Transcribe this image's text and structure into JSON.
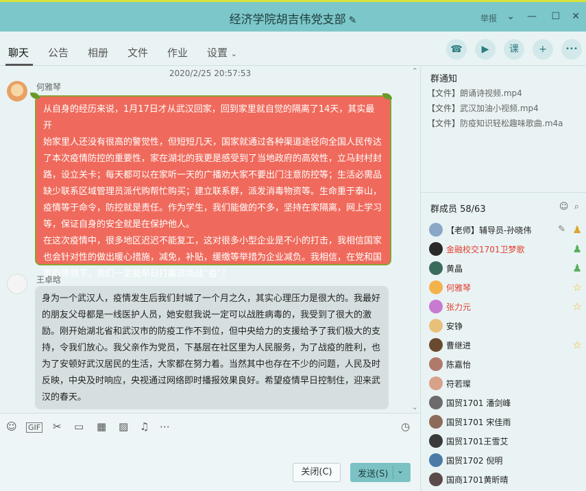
{
  "window": {
    "title": "经济学院胡吉伟党支部",
    "report_label": "举报",
    "controls": [
      "⌄",
      "—",
      "☐",
      "✕"
    ]
  },
  "tabs": [
    "聊天",
    "公告",
    "相册",
    "文件",
    "作业",
    "设置"
  ],
  "active_tab": "聊天",
  "header_icons": [
    "phone-icon",
    "video-icon",
    "class-icon",
    "add-chat-icon",
    "more-icon"
  ],
  "header_icon_glyphs": [
    "☎",
    "▶",
    "课",
    "+",
    "•••"
  ],
  "chat": {
    "timestamp": "2020/2/25 20:57:53",
    "messages": [
      {
        "sender": "何雅琴",
        "lines": [
          "从自身的经历来说，1月17日才从武汉回家，回到家里就自觉的隔离了14天，其实最开",
          "始家里人还没有很高的警觉性，但短短几天，国家就通过各种渠道途径向全国人民传达",
          "了本次疫情防控的重要性，家在湖北的我更是感受到了当地政府的高效性，立马封村封",
          "路，设立关卡；每天都可以在家听一天的广播劝大家不要出门注意防控等；生活必需品",
          "缺少联系区域管理员派代购帮忙购买；建立联系群，派发消毒物资等。生命重于泰山，",
          "疫情等于命令，防控就是责任。作为学生，我们能做的不多，坚持在家隔离，网上学习",
          "等，保证自身的安全就是在保护他人。",
          "在这次疫情中，很多地区迟迟不能复工，这对很多小型企业是不小的打击，我相信国家",
          "也会针对性的做出暖心措施，减免，补贴，缓缴等举措为企业减负。我相信，在党和国",
          "家的带领下，我们一定能早日打赢这场战“疫”！"
        ]
      },
      {
        "sender": "王卓晗",
        "lines": [
          "身为一个武汉人，疫情发生后我们封城了一个月之久，其实心理压力是很大的。我最好",
          "的朋友父母都是一线医护人员，她安慰我说一定可以战胜病毒的，我受到了很大的激",
          "励。刚开始湖北省和武汉市的防疫工作不到位，但中央给力的支援给予了我们极大的支",
          "持，令我们放心。我父亲作为党员，下基层在社区里为人民服务，为了战疫的胜利，也",
          "为了安顿好武汉居民的生活，大家都在努力着。当然其中也存在不少的问题，人民及时",
          "反映，中央及时响应，央视通过网络即时播报效果良好。希望疫情早日控制住，迎来武",
          "汉的春天。"
        ]
      }
    ]
  },
  "toolbar": {
    "icons": [
      "emoji-icon",
      "gif-icon",
      "scissors-icon",
      "folder-icon",
      "template-icon",
      "image-icon",
      "bell-icon",
      "more-icon",
      "history-icon"
    ],
    "glyphs": [
      "☺",
      "GIF",
      "✂",
      "▭",
      "▦",
      "▨",
      "♫",
      "⋯",
      "◷"
    ]
  },
  "buttons": {
    "close": "关闭(C)",
    "send": "发送(S)",
    "send_arrow": "⌄"
  },
  "notice": {
    "heading": "群通知",
    "files": [
      {
        "prefix": "【文件】",
        "name": "朗诵诗视频.mp4"
      },
      {
        "prefix": "【文件】",
        "name": "武汉加油小视频.mp4"
      },
      {
        "prefix": "【文件】",
        "name": "防疫知识轻松趣味歌曲.m4a"
      }
    ]
  },
  "members": {
    "heading": "群成员 58/63",
    "header_icons": [
      "☺",
      "⌕"
    ],
    "list": [
      {
        "name": "【老师】辅导员-孙晓伟",
        "red": false,
        "badge": "owner",
        "editable": true
      },
      {
        "name": "金融校交1701卫梦歌",
        "red": true,
        "badge": "admin",
        "editable": false
      },
      {
        "name": "黄晶",
        "red": false,
        "badge": "admin",
        "editable": false
      },
      {
        "name": "何雅琴",
        "red": true,
        "badge": "star",
        "editable": false
      },
      {
        "name": "张力元",
        "red": true,
        "badge": "star",
        "editable": false
      },
      {
        "name": "安铮",
        "red": false,
        "badge": "",
        "editable": false
      },
      {
        "name": "曹继进",
        "red": false,
        "badge": "star",
        "editable": false
      },
      {
        "name": "陈嘉怡",
        "red": false,
        "badge": "",
        "editable": false
      },
      {
        "name": "符若璨",
        "red": false,
        "badge": "",
        "editable": false
      },
      {
        "name": "国贸1701  潘剑峰",
        "red": false,
        "badge": "",
        "editable": false
      },
      {
        "name": "国贸1701 宋佳雨",
        "red": false,
        "badge": "",
        "editable": false
      },
      {
        "name": "国贸1701王雪艾",
        "red": false,
        "badge": "",
        "editable": false
      },
      {
        "name": "国贸1702 倪明",
        "red": false,
        "badge": "",
        "editable": false
      },
      {
        "name": "国商1701黄昕晴",
        "red": false,
        "badge": "",
        "editable": false
      }
    ]
  },
  "colors": {
    "title_bar": "#7cc7c9",
    "red_bubble": "#ef6a5c",
    "grey_bubble": "#d6dfe0",
    "member_red": "#e23d2e",
    "star": "#f2b51d"
  }
}
